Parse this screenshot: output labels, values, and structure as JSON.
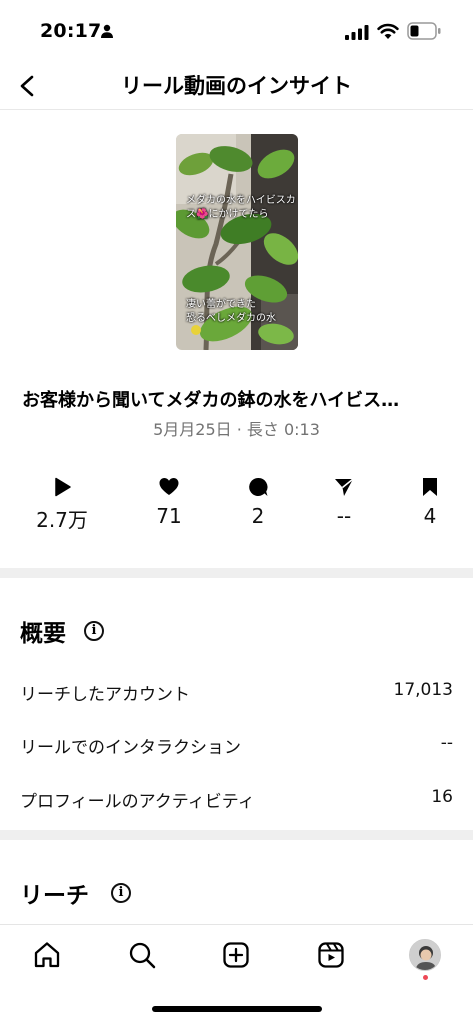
{
  "status_bar": {
    "time": "20:17",
    "icons": [
      "person-icon",
      "signal-icon",
      "wifi-icon",
      "battery-icon"
    ]
  },
  "header": {
    "title": "リール動画のインサイト",
    "back_icon": "chevron-left-icon"
  },
  "reel": {
    "caption_overlay_1a": "メダカの水をハイビスカ",
    "caption_overlay_1b": "ス🌺にかけてたら",
    "caption_overlay_2a": "凄い蕾ができた",
    "caption_overlay_2b": "恐るべしメダカの水",
    "title": "お客様から聞いてメダカの鉢の水をハイビス…",
    "meta": "5月月25日 · 長さ 0:13"
  },
  "stats": [
    {
      "icon": "play-icon",
      "value": "2.7万"
    },
    {
      "icon": "heart-icon",
      "value": "71"
    },
    {
      "icon": "comment-icon",
      "value": "2"
    },
    {
      "icon": "share-icon",
      "value": "--"
    },
    {
      "icon": "bookmark-icon",
      "value": "4"
    }
  ],
  "overview": {
    "title": "概要",
    "info_icon": "info-icon",
    "rows": [
      {
        "label": "リーチしたアカウント",
        "value": "17,013"
      },
      {
        "label": "リールでのインタラクション",
        "value": "--"
      },
      {
        "label": "プロフィールのアクティビティ",
        "value": "16"
      }
    ]
  },
  "reach": {
    "title": "リーチ",
    "info_icon": "info-icon"
  },
  "bottom_nav": [
    "home-icon",
    "search-icon",
    "create-icon",
    "reels-icon",
    "profile-avatar"
  ],
  "colors": {
    "meta_gray": "#737373",
    "separator": "#efefef",
    "notification_dot": "#ed4956"
  }
}
